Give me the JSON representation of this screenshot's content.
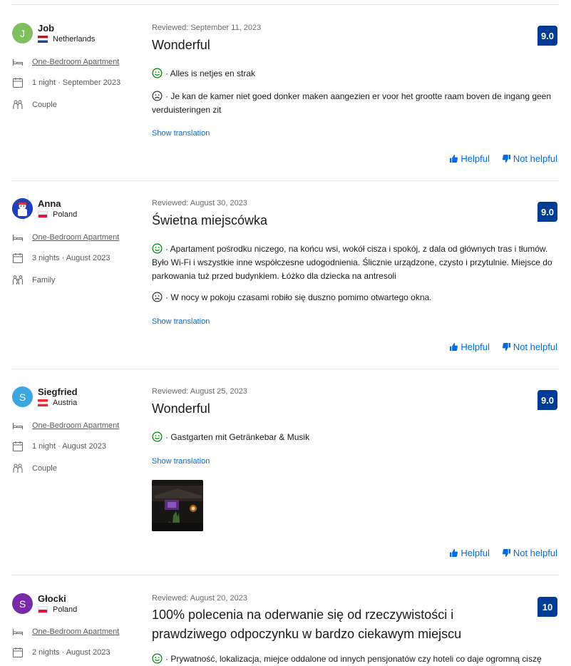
{
  "labels": {
    "show_translation": "Show translation",
    "helpful": "Helpful",
    "not_helpful": "Not helpful"
  },
  "colors": {
    "score_bg": "#003b95",
    "link": "#006ce4",
    "positive": "#008009"
  },
  "reviews": [
    {
      "initial": "J",
      "avatar_color": "#7fbf5e",
      "name": "Job",
      "country": "Netherlands",
      "room": "One-Bedroom Apartment",
      "stay": "1 night · September 2023",
      "traveler": "Couple",
      "reviewed": "Reviewed: September 11, 2023",
      "title": "Wonderful",
      "score": "9.0",
      "positive": "· Alles is netjes en strak",
      "negative": "· Je kan de kamer niet goed donker maken aangezien er voor het grootte raam boven de ingang geen verduisteringen zit"
    },
    {
      "initial": "",
      "avatar_color": "#1f3fbf",
      "name": "Anna",
      "country": "Poland",
      "room": "One-Bedroom Apartment",
      "stay": "3 nights · August 2023",
      "traveler": "Family",
      "reviewed": "Reviewed: August 30, 2023",
      "title": "Świetna miejscówka",
      "score": "9.0",
      "positive": "· Apartament pośrodku niczego, na końcu wsi, wokół cisza i spokój, z dala od głównych tras i tłumów. Było Wi-Fi i wszystkie inne współczesne udogodnienia. Ślicznie urządzone, czysto i przytulnie. Miejsce do parkowania tuż przed budynkiem. Łóżko dla dziecka na antresoli",
      "negative": "· W nocy w pokoju czasami robiło się duszno pomimo otwartego okna."
    },
    {
      "initial": "S",
      "avatar_color": "#3aa7e0",
      "name": "Siegfried",
      "country": "Austria",
      "room": "One-Bedroom Apartment",
      "stay": "1 night · August 2023",
      "traveler": "Couple",
      "reviewed": "Reviewed: August 25, 2023",
      "title": "Wonderful",
      "score": "9.0",
      "positive": "· Gastgarten mit Getränkebar & Musik"
    },
    {
      "initial": "S",
      "avatar_color": "#7a2aa8",
      "name": "Głocki",
      "country": "Poland",
      "room": "One-Bedroom Apartment",
      "stay": "2 nights · August 2023",
      "reviewed": "Reviewed: August 20, 2023",
      "title": "100% polecenia na oderwanie się od rzeczywistości i prawdziwego odpoczynku w bardzo ciekawym miejscu",
      "score": "10",
      "positive": "· Prywatność, lokalizacja, miejce oddalone od innych pensjonatów czy hoteli co daje ogromną ciszę"
    }
  ]
}
